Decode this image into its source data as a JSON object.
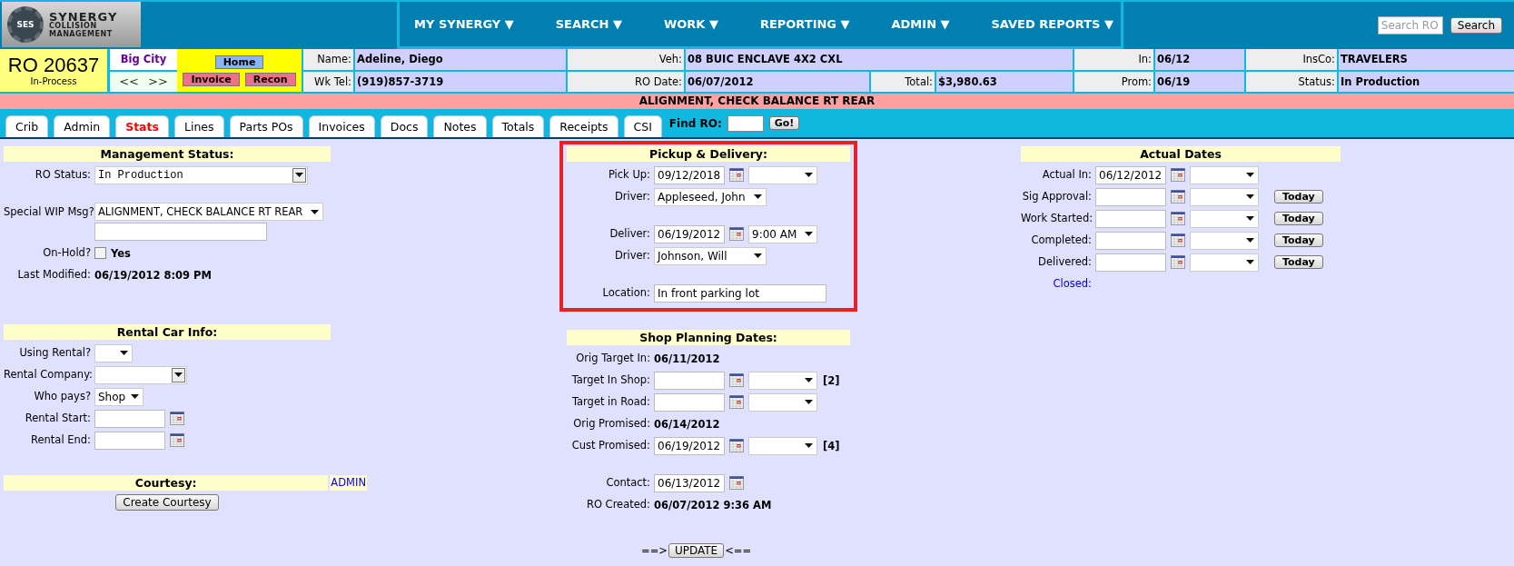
{
  "logo": {
    "badge": "SES",
    "line_1": "SYNERGY",
    "line_2": "COLLISION",
    "line_3": "MANAGEMENT"
  },
  "nav": [
    {
      "label": "MY SYNERGY ▼"
    },
    {
      "label": "SEARCH ▼"
    },
    {
      "label": "WORK ▼"
    },
    {
      "label": "REPORTING ▼"
    },
    {
      "label": "ADMIN ▼"
    },
    {
      "label": "SAVED REPORTS ▼"
    }
  ],
  "search": {
    "placeholder": "Search RO",
    "button": "Search"
  },
  "ro": {
    "number": "RO 20637",
    "status": "In-Process",
    "shop": "Big City",
    "prev": "<<",
    "next": ">>"
  },
  "actions": [
    {
      "label": "Home",
      "kind": "nav"
    },
    {
      "label": "Invoice",
      "kind": "alert"
    },
    {
      "label": "Recon",
      "kind": "alert"
    }
  ],
  "info_rows": [
    [
      {
        "label": "Name:",
        "value": "Adeline, Diego"
      },
      {
        "label": "Veh:",
        "value": "08 BUIC ENCLAVE 4X2 CXL"
      },
      {
        "label": "In:",
        "value": "06/12"
      },
      {
        "label": "InsCo:",
        "value": "TRAVELERS"
      }
    ],
    [
      {
        "label": "Wk Tel:",
        "value": "(919)857-3719"
      },
      {
        "label": "RO Date:",
        "value": "06/07/2012"
      },
      {
        "label": "Total:",
        "value": "$3,980.63"
      },
      {
        "label": "Prom:",
        "value": "06/19"
      },
      {
        "label": "Status:",
        "value": "In Production"
      }
    ]
  ],
  "alert_message": "ALIGNMENT, CHECK BALANCE RT REAR",
  "tabs": [
    {
      "label": "Crib",
      "selected": false
    },
    {
      "label": "Admin",
      "selected": false
    },
    {
      "label": "Stats",
      "selected": true
    },
    {
      "label": "Lines",
      "selected": false
    },
    {
      "label": "Parts POs",
      "selected": false
    },
    {
      "label": "Invoices",
      "selected": false
    },
    {
      "label": "Docs",
      "selected": false
    },
    {
      "label": "Notes",
      "selected": false
    },
    {
      "label": "Totals",
      "selected": false
    },
    {
      "label": "Receipts",
      "selected": false
    },
    {
      "label": "CSI",
      "selected": false
    }
  ],
  "find_ro": {
    "label": "Find RO:",
    "button": "Go!"
  },
  "management": {
    "title": "Management Status:",
    "groups": [
      [
        {
          "kind": "status_select",
          "label": "RO Status:",
          "value": "In Production"
        }
      ],
      [
        {
          "kind": "message_select",
          "label": "Special WIP Msg?",
          "value": "ALIGNMENT, CHECK BALANCE RT REAR"
        },
        {
          "kind": "checkbox",
          "label": "On-Hold?",
          "checked": false,
          "value": "Yes"
        },
        {
          "kind": "static",
          "label": "Last Modified:",
          "value": "06/19/2012 8:09 PM"
        }
      ]
    ]
  },
  "rental": {
    "title": "Rental Car Info:",
    "groups": [
      [
        {
          "kind": "select",
          "label": "Using Rental?"
        },
        {
          "kind": "combo",
          "label": "Rental Company:"
        },
        {
          "kind": "select",
          "label": "Who pays?",
          "value": "Shop"
        },
        {
          "kind": "date",
          "label": "Rental Start:"
        },
        {
          "kind": "date",
          "label": "Rental End:"
        }
      ]
    ]
  },
  "courtesy": {
    "title": "Courtesy:",
    "link": "ADMIN",
    "button": "Create Courtesy"
  },
  "pickup": {
    "title": "Pickup & Delivery:",
    "highlighted": true,
    "groups": [
      [
        {
          "kind": "datetime",
          "label": "Pick Up:",
          "value": "09/12/2018"
        },
        {
          "kind": "select",
          "label": "Driver:",
          "value": "Appleseed, John"
        }
      ],
      [
        {
          "kind": "datetime",
          "label": "Deliver:",
          "value": "06/19/2012",
          "time": "9:00 AM"
        },
        {
          "kind": "select",
          "label": "Driver:",
          "value": "Johnson, Will"
        }
      ],
      [
        {
          "kind": "text",
          "label": "Location:",
          "value": "In front parking lot"
        }
      ]
    ]
  },
  "planning": {
    "title": "Shop Planning Dates:",
    "groups": [
      [
        {
          "kind": "static",
          "label": "Orig Target In:",
          "value": "06/11/2012"
        },
        {
          "kind": "datetime",
          "label": "Target In Shop:",
          "note": "[2]"
        },
        {
          "kind": "datetime",
          "label": "Target in Road:"
        },
        {
          "kind": "static",
          "label": "Orig Promised:",
          "value": "06/14/2012"
        },
        {
          "kind": "datetime",
          "label": "Cust Promised:",
          "value": "06/19/2012",
          "note": "[4]"
        }
      ],
      [
        {
          "kind": "date",
          "label": "Contact:",
          "value": "06/13/2012"
        },
        {
          "kind": "static",
          "label": "RO Created:",
          "value": "06/07/2012 9:36 AM"
        }
      ]
    ]
  },
  "actual": {
    "title": "Actual Dates",
    "groups": [
      [
        {
          "kind": "datetime",
          "label": "Actual In:",
          "value": "06/12/2012"
        },
        {
          "kind": "datetime",
          "label": "Sig Approval:",
          "button": "Today"
        },
        {
          "kind": "datetime",
          "label": "Work Started:",
          "button": "Today"
        },
        {
          "kind": "datetime",
          "label": "Completed:",
          "button": "Today"
        },
        {
          "kind": "datetime",
          "label": "Delivered:",
          "button": "Today"
        },
        {
          "kind": "link_label",
          "label": "Closed:"
        }
      ]
    ]
  },
  "update": {
    "before": "==>",
    "button": "UPDATE",
    "after": "<=="
  }
}
